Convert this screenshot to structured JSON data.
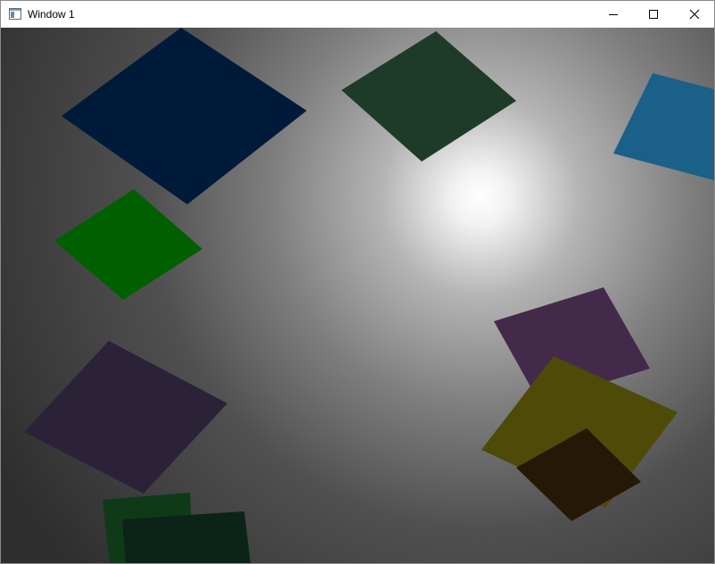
{
  "window": {
    "title": "Window 1"
  },
  "titlebar": {
    "app_icon": "window-app-icon",
    "buttons": [
      {
        "name": "minimize",
        "icon": "minimize-icon"
      },
      {
        "name": "maximize",
        "icon": "maximize-icon"
      },
      {
        "name": "close",
        "icon": "close-icon"
      }
    ]
  },
  "scene": {
    "background_center_color": "#ffffff",
    "background_edge_color": "#2e2e2e",
    "quads": [
      {
        "name": "navy-quad",
        "color": "#001a3a"
      },
      {
        "name": "dark-green-quad",
        "color": "#1e3a28"
      },
      {
        "name": "cyan-quad",
        "color": "#1a6088"
      },
      {
        "name": "green-quad",
        "color": "#006000"
      },
      {
        "name": "purple-quad-left",
        "color": "#2c2238"
      },
      {
        "name": "purple-quad-right",
        "color": "#432a4a"
      },
      {
        "name": "olive-quad",
        "color": "#4e4a08"
      },
      {
        "name": "brown-quad",
        "color": "#241806"
      },
      {
        "name": "green-quad-bottom-back",
        "color": "#0e3a18"
      },
      {
        "name": "green-quad-bottom-front",
        "color": "#0c2418"
      }
    ]
  }
}
